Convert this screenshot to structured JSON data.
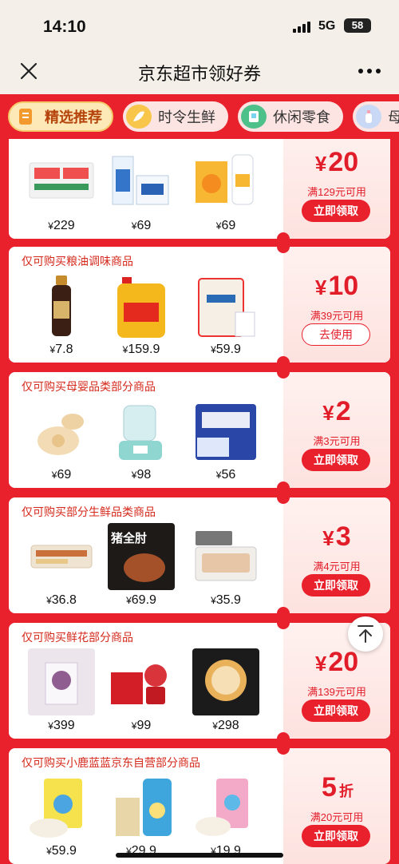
{
  "status_bar": {
    "time": "14:10",
    "network": "5G",
    "battery": "58"
  },
  "nav": {
    "title": "京东超市领好券",
    "close_icon": "close-icon",
    "more_icon": "more-icon"
  },
  "tabs": [
    {
      "label": "精选推荐",
      "icon": "coupon-icon",
      "active": true
    },
    {
      "label": "时令生鲜",
      "icon": "fresh-icon",
      "active": false
    },
    {
      "label": "休闲零食",
      "icon": "snack-icon",
      "active": false
    },
    {
      "label": "母",
      "icon": "baby-bottle-icon",
      "active": false
    }
  ],
  "coupons": [
    {
      "title": "",
      "prices": [
        "229",
        "69",
        "69"
      ],
      "products": [
        "toothpaste-box-image",
        "milk-carton-image",
        "juice-bottles-image"
      ],
      "amount_symbol": "¥",
      "amount": "20",
      "unit": "",
      "condition": "满129元可用",
      "button": "立即领取",
      "button_type": "claim"
    },
    {
      "title": "仅可购买粮油调味商品",
      "prices": [
        "7.8",
        "159.9",
        "59.9"
      ],
      "products": [
        "soy-sauce-bottle-image",
        "cooking-oil-image",
        "rice-bag-image"
      ],
      "amount_symbol": "¥",
      "amount": "10",
      "unit": "",
      "condition": "满39元可用",
      "button": "去使用",
      "button_type": "use"
    },
    {
      "title": "仅可购买母婴品类部分商品",
      "prices": [
        "69",
        "98",
        "56"
      ],
      "products": [
        "pacifier-image",
        "bottle-warmer-image",
        "diaper-pack-image"
      ],
      "amount_symbol": "¥",
      "amount": "2",
      "unit": "",
      "condition": "满3元可用",
      "button": "立即领取",
      "button_type": "claim"
    },
    {
      "title": "仅可购买部分生鲜品类商品",
      "prices": [
        "36.8",
        "69.9",
        "35.9"
      ],
      "products": [
        "sausage-pack-image",
        "pork-knuckle-image",
        "fish-tray-image"
      ],
      "amount_symbol": "¥",
      "amount": "3",
      "unit": "",
      "condition": "满4元可用",
      "button": "立即领取",
      "button_type": "claim",
      "product_caption": "猪全肘"
    },
    {
      "title": "仅可购买鲜花部分商品",
      "prices": [
        "399",
        "99",
        "298"
      ],
      "products": [
        "flower-gift-box-image",
        "red-flower-box-image",
        "flower-lamp-image"
      ],
      "amount_symbol": "¥",
      "amount": "20",
      "unit": "",
      "condition": "满139元可用",
      "button": "立即领取",
      "button_type": "claim"
    },
    {
      "title": "仅可购买小鹿蓝蓝京东自营部分商品",
      "prices": [
        "59.9",
        "29.9",
        "19.9"
      ],
      "products": [
        "baby-snack-image",
        "biscuit-stick-image",
        "baby-cereal-image"
      ],
      "amount_symbol": "",
      "amount": "5",
      "unit": "折",
      "condition": "满20元可用",
      "button": "立即领取",
      "button_type": "claim"
    }
  ],
  "price_symbol": "¥",
  "back_to_top_icon": "arrow-up-icon",
  "colors": {
    "brand_red": "#e8212c",
    "price_red": "#e21d2a",
    "tab_active_bg": "#fde9b8",
    "nav_bg": "#f4efe8"
  }
}
